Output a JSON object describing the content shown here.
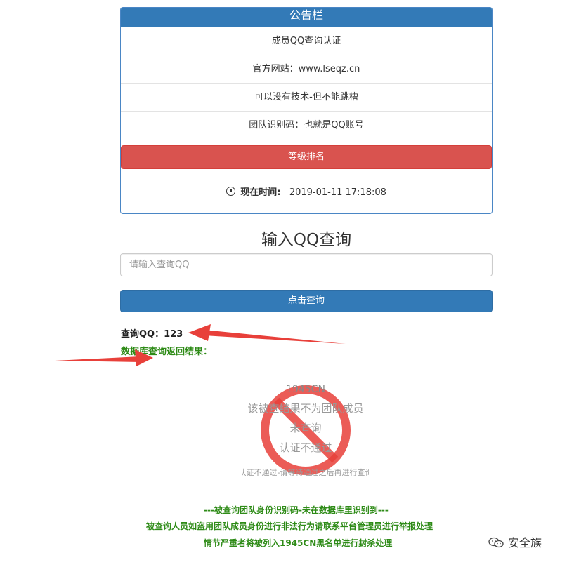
{
  "notice_board": {
    "title": "公告栏",
    "rows": [
      "成员QQ查询认证",
      "官方网站：www.lseqz.cn",
      "可以没有技术-但不能跳槽",
      "团队识别码：也就是QQ账号"
    ],
    "rank_button": "等级排名",
    "time_label": "现在时间:",
    "time_value": "2019-01-11 17:18:08"
  },
  "query": {
    "title": "输入QQ查询",
    "placeholder": "请输入查询QQ",
    "button": "点击查询"
  },
  "result": {
    "queried_qq": "查询QQ：123",
    "db_result_label": "数据库查询返回结果："
  },
  "stamp": {
    "lines": [
      "1945CN",
      "该被查结果不为团队成员",
      "未查询",
      "认证不通过",
      "认证不通过-请等待通过之后再进行查询"
    ]
  },
  "warnings": [
    "---被查询团队身份识别码-未在数据库里识别到---",
    "被查询人员如盗用团队成员身份进行非法行为请联系平台管理员进行举报处理",
    "情节严重者将被列入1945CN黑名单进行封杀处理"
  ],
  "watermark": "安全族",
  "colors": {
    "primary": "#337ab7",
    "danger": "#d9534f",
    "success_text": "#2e8b17",
    "annotation_arrow": "#e8403a"
  }
}
